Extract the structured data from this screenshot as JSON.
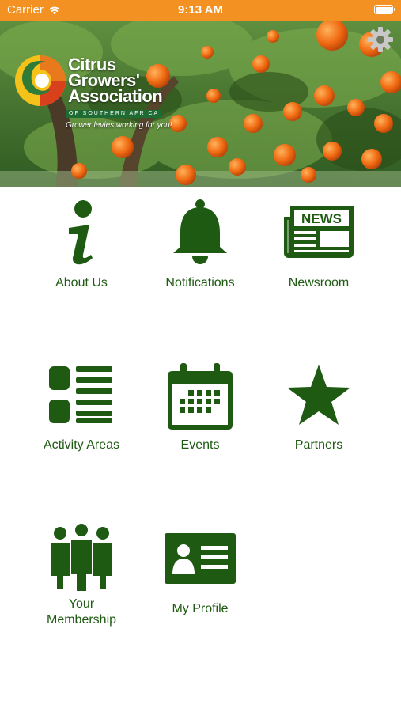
{
  "status_bar": {
    "carrier": "Carrier",
    "time": "9:13 AM",
    "battery_level": 1.0
  },
  "header": {
    "logo_lines": [
      "Citrus",
      "Growers'",
      "Association"
    ],
    "logo_subline": "OF SOUTHERN AFRICA",
    "tagline": "Grower levies working for you!"
  },
  "colors": {
    "status_bar": "#f39222",
    "icon_green": "#1e5a12",
    "label_green": "#1e5a12"
  },
  "menu": {
    "about_us": {
      "label": "About Us",
      "icon": "info-icon"
    },
    "notifications": {
      "label": "Notifications",
      "icon": "bell-icon"
    },
    "newsroom": {
      "label": "Newsroom",
      "icon": "newspaper-icon",
      "icon_text": "NEWS"
    },
    "activity_areas": {
      "label": "Activity Areas",
      "icon": "list-icon"
    },
    "events": {
      "label": "Events",
      "icon": "calendar-icon"
    },
    "partners": {
      "label": "Partners",
      "icon": "star-icon"
    },
    "your_membership": {
      "label_line1": "Your",
      "label_line2": "Membership",
      "icon": "group-icon"
    },
    "my_profile": {
      "label": "My Profile",
      "icon": "id-card-icon"
    }
  }
}
